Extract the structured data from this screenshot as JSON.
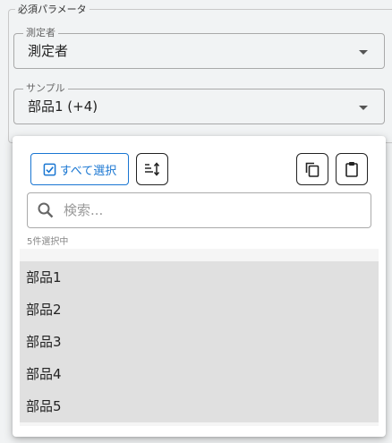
{
  "section": {
    "legend": "必須パラメータ"
  },
  "measurer": {
    "label": "測定者",
    "value": "測定者"
  },
  "sample": {
    "label": "サンプル",
    "value": "部品1 (+4)"
  },
  "popup": {
    "select_all_label": "すべて選択",
    "search_placeholder": "検索...",
    "count_text": "5件選択中",
    "items": [
      "部品1",
      "部品2",
      "部品3",
      "部品4",
      "部品5"
    ]
  },
  "colors": {
    "accent": "#1976d2",
    "selected_bg": "#e0e0e0"
  }
}
